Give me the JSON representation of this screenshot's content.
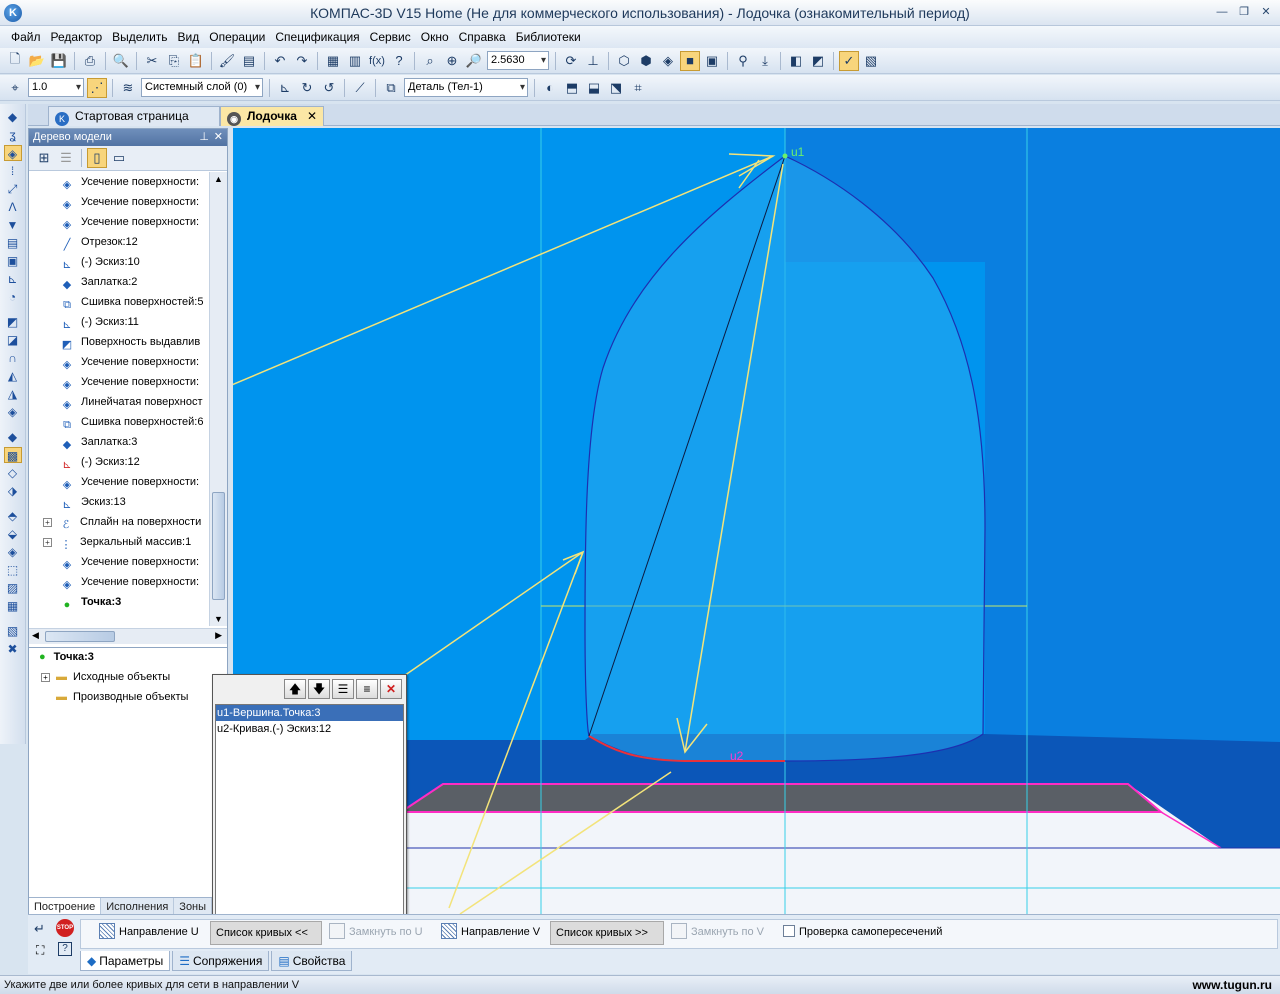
{
  "window": {
    "title": "КОМПАС-3D V15 Home (Не для коммерческого использования) - Лодочка (ознакомительный период)"
  },
  "menu": [
    "Файл",
    "Редактор",
    "Выделить",
    "Вид",
    "Операции",
    "Спецификация",
    "Сервис",
    "Окно",
    "Справка",
    "Библиотеки"
  ],
  "toolbar": {
    "zoom_value": "2.5630",
    "step_value": "1.0",
    "layer_value": "Системный слой (0)",
    "part_value": "Деталь (Тел-1)"
  },
  "tabs": {
    "start": "Стартовая страница",
    "document": "Лодочка"
  },
  "tree": {
    "title": "Дерево модели",
    "items": [
      {
        "label": "Усечение поверхности:",
        "icon": "surface-cut-icon",
        "expand": false
      },
      {
        "label": "Усечение поверхности:",
        "icon": "surface-cut-icon",
        "expand": false
      },
      {
        "label": "Усечение поверхности:",
        "icon": "surface-cut-icon",
        "expand": false
      },
      {
        "label": "Отрезок:12",
        "icon": "segment-icon",
        "expand": false
      },
      {
        "label": "(-) Эскиз:10",
        "icon": "sketch-icon",
        "expand": false
      },
      {
        "label": "Заплатка:2",
        "icon": "patch-icon",
        "expand": false
      },
      {
        "label": "Сшивка поверхностей:5",
        "icon": "stitch-icon",
        "expand": false
      },
      {
        "label": "(-) Эскиз:11",
        "icon": "sketch-icon",
        "expand": false
      },
      {
        "label": "Поверхность выдавлив",
        "icon": "extrude-surface-icon",
        "expand": false
      },
      {
        "label": "Усечение поверхности:",
        "icon": "surface-cut-icon",
        "expand": false
      },
      {
        "label": "Усечение поверхности:",
        "icon": "surface-cut-icon",
        "expand": false
      },
      {
        "label": "Линейчатая поверхност",
        "icon": "ruled-surface-icon",
        "expand": false
      },
      {
        "label": "Сшивка поверхностей:6",
        "icon": "stitch-icon",
        "expand": false
      },
      {
        "label": "Заплатка:3",
        "icon": "patch-icon",
        "expand": false
      },
      {
        "label": "(-) Эскиз:12",
        "icon": "sketch-red-icon",
        "expand": false
      },
      {
        "label": "Усечение поверхности:",
        "icon": "surface-cut-icon",
        "expand": false
      },
      {
        "label": "Эскиз:13",
        "icon": "sketch-icon",
        "expand": false
      },
      {
        "label": "Сплайн на поверхности",
        "icon": "spline-icon",
        "expand": true
      },
      {
        "label": "Зеркальный массив:1",
        "icon": "mirror-icon",
        "expand": true
      },
      {
        "label": "Усечение поверхности:",
        "icon": "surface-cut-icon",
        "expand": false
      },
      {
        "label": "Усечение поверхности:",
        "icon": "surface-cut-icon",
        "expand": false
      },
      {
        "label": "Точка:3",
        "icon": "point-icon",
        "expand": false
      }
    ],
    "detail_title": "Точка:3",
    "detail_items": [
      "Исходные объекты",
      "Производные объекты"
    ],
    "bottom_tabs": [
      "Построение",
      "Исполнения",
      "Зоны"
    ]
  },
  "popup": {
    "items": [
      "u1-Вершина.Точка:3",
      "u2-Кривая.(-) Эскиз:12"
    ]
  },
  "viewport": {
    "label_u1": "u1",
    "label_u2": "u2"
  },
  "properties": {
    "dir_u": "Направление U",
    "curve_list_u": "Список кривых   <<",
    "close_u": "Замкнуть по U",
    "dir_v": "Направление V",
    "curve_list_v": "Список кривых   >>",
    "close_v": "Замкнуть по V",
    "self_intersect": "Проверка самопересечений",
    "tabs": [
      "Параметры",
      "Сопряжения",
      "Свойства"
    ]
  },
  "status": {
    "text": "Укажите две или более кривых для сети в направлении V",
    "watermark": "www.tugun.ru"
  },
  "colors": {
    "viewport_bg": "#0096f0",
    "accent": "#f8d57c",
    "yellow_arrow": "#f3e37a"
  }
}
